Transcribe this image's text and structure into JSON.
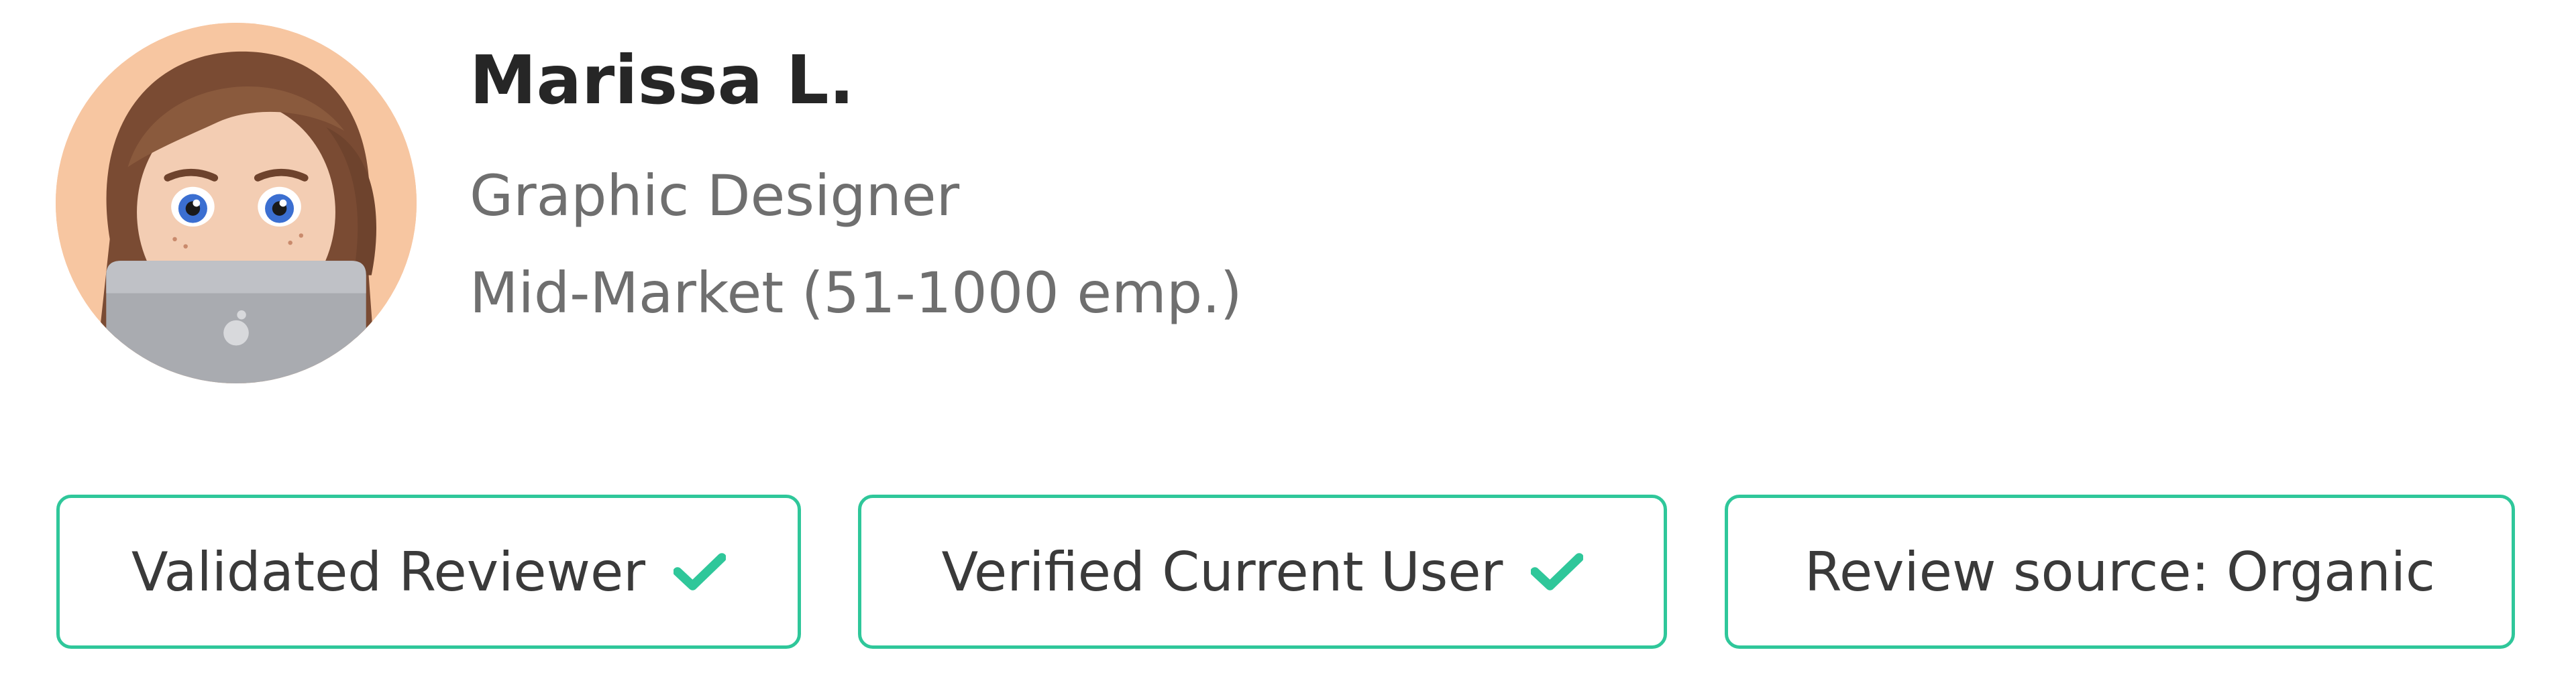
{
  "reviewer": {
    "name": "Marissa L.",
    "role": "Graphic Designer",
    "segment": "Mid-Market (51-1000 emp.)",
    "avatar_icon": "memoji-avatar-with-laptop"
  },
  "badges": [
    {
      "label": "Validated Reviewer",
      "icon": "check-icon"
    },
    {
      "label": "Verified Current User",
      "icon": "check-icon"
    },
    {
      "label": "Review source: Organic"
    }
  ],
  "colors": {
    "badge_border": "#2fc79a",
    "check": "#2fc79a",
    "name_text": "#262626",
    "secondary_text": "#6f6f6f",
    "avatar_bg": "#f6c59f"
  }
}
